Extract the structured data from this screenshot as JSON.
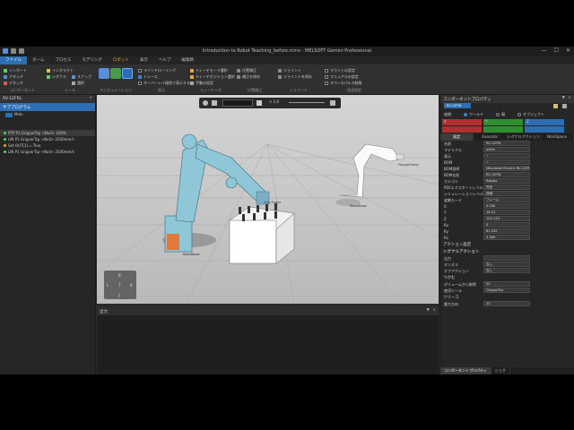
{
  "window": {
    "title": "Introduction to Robot Teaching_before.rcmx - MELSOFT Gemini Professional",
    "controls": [
      "—",
      "☐",
      "✕"
    ]
  },
  "menubar": {
    "items": [
      "ファイル",
      "ホーム",
      "プロセス",
      "モデリング",
      "ツール",
      "表示",
      "ヘルプ"
    ],
    "tool_tab": "ロボット",
    "active": "ファイル",
    "extra": "編集精"
  },
  "ribbon": {
    "group_component": {
      "label": "コンポーネント",
      "items": [
        "インポート",
        "アタッチ",
        "デタッチ"
      ]
    },
    "group_tool": {
      "label": "ツール",
      "items": [
        "インタラクト",
        "シグナル",
        "スナップ",
        "選択"
      ],
      "buttons": [
        "移動",
        "回転"
      ]
    },
    "group_main": {
      "label": "マニピュレーション",
      "items": [
        "移動",
        "回転",
        "PnP"
      ]
    },
    "group_display": {
      "label": "表示",
      "items": [
        "ラインドローイング",
        "トレース",
        "オーバーレイ接続で表示する"
      ]
    },
    "group_teach": {
      "label": "ティーチング",
      "items": [
        "ティーチモード選択",
        "ティーチポジション選択",
        "手動の設定"
      ]
    },
    "group_position": {
      "label": "位置補正",
      "items": [
        "位置補正",
        "補正を保存"
      ]
    },
    "group_joint": {
      "label": "ジョイント",
      "items": [
        "ジョイント",
        "ジョイントを保存"
      ]
    },
    "group_config": {
      "label": "用途設定",
      "items": [
        "マウントの設定",
        "マニュアルの設定",
        "スペースパルス制限"
      ]
    }
  },
  "left_panel": {
    "title": "RV-12FRL",
    "close": "×",
    "sub_title": "サブプログラム",
    "main_label": "Main",
    "statements": [
      "PTP P1 GripperTcp <Null> 100%",
      "LIN P1 GripperTcp <Null> 2500mm/s",
      "Set OUT[1] = True",
      "LIN P1 GripperTcp <Null> 2500mm/s"
    ]
  },
  "viewport": {
    "toolbar_speed": "× 1.0",
    "labels": {
      "robot_main": "RobotBase",
      "robot_main_frame": "Grip Frame",
      "robot_right": "RobotBase",
      "right_frame": "FlangeFrame"
    }
  },
  "output_panel": {
    "title": "出力",
    "pin": "▼",
    "close": "×"
  },
  "right_panel": {
    "title": "コンポーネントプロパティ",
    "pin": "▼",
    "close": "×",
    "component_name": "RV-12FRL",
    "coord_label": "座標",
    "coord_options": [
      "ワールド",
      "親",
      "オブジェクト"
    ],
    "coord_selected": "ワールド",
    "xyz_x": "X",
    "xyz_y": "Y",
    "xyz_z": "Z",
    "tabs": [
      "既定",
      "Executor",
      "シグナルアクション",
      "WorkSpace"
    ],
    "tab_active": "既定",
    "properties": [
      {
        "k": "名前",
        "v": "RV-12FRL"
      },
      {
        "k": "マテリアル",
        "v": "white"
      },
      {
        "k": "表示",
        "v": "✓"
      },
      {
        "k": "BOM",
        "v": "✓"
      },
      {
        "k": "BOM説明",
        "v": "Mitsubishi Electric RV-12FRL"
      },
      {
        "k": "BOM名前",
        "v": "RV-12FRL"
      },
      {
        "k": "カテゴリ",
        "v": "Robots"
      },
      {
        "k": "PDFエクスポートレベル",
        "v": "完全"
      },
      {
        "k": "シミュレーションレベル",
        "v": "詳細"
      },
      {
        "k": "姿勢モード",
        "v": "フレーム"
      },
      {
        "k": "X",
        "v": "0.000"
      },
      {
        "k": "Y",
        "v": "18.51"
      },
      {
        "k": "Z",
        "v": "102.133"
      },
      {
        "k": "Rx",
        "v": "0"
      },
      {
        "k": "Ry",
        "v": "61.292"
      },
      {
        "k": "Rz",
        "v": "3.389"
      }
    ],
    "action_section": "アクション設定",
    "signal_section": "シグナルアクション",
    "signal_rows": [
      {
        "k": "出力",
        "v": ""
      },
      {
        "k": "オンオル",
        "v": "なし"
      },
      {
        "k": "オフアクション",
        "v": "なし"
      }
    ],
    "grip_section": "つかむ",
    "grip_rows": [
      {
        "k": "ボリュームから取得",
        "v": "50"
      },
      {
        "k": "使用ツール",
        "v": "GripperTcp"
      }
    ],
    "release_section": "リリース",
    "release_rows": [
      {
        "k": "重力方向",
        "v": "23"
      }
    ],
    "bottom_tabs": [
      "コンポーネントプロパティ",
      "ジョグ"
    ],
    "bottom_active": "コンポーネントプロパティ"
  },
  "colors": {
    "accent": "#2d6db3",
    "robot": "#8fc6d8",
    "tool_tab": "#f0a13c"
  }
}
